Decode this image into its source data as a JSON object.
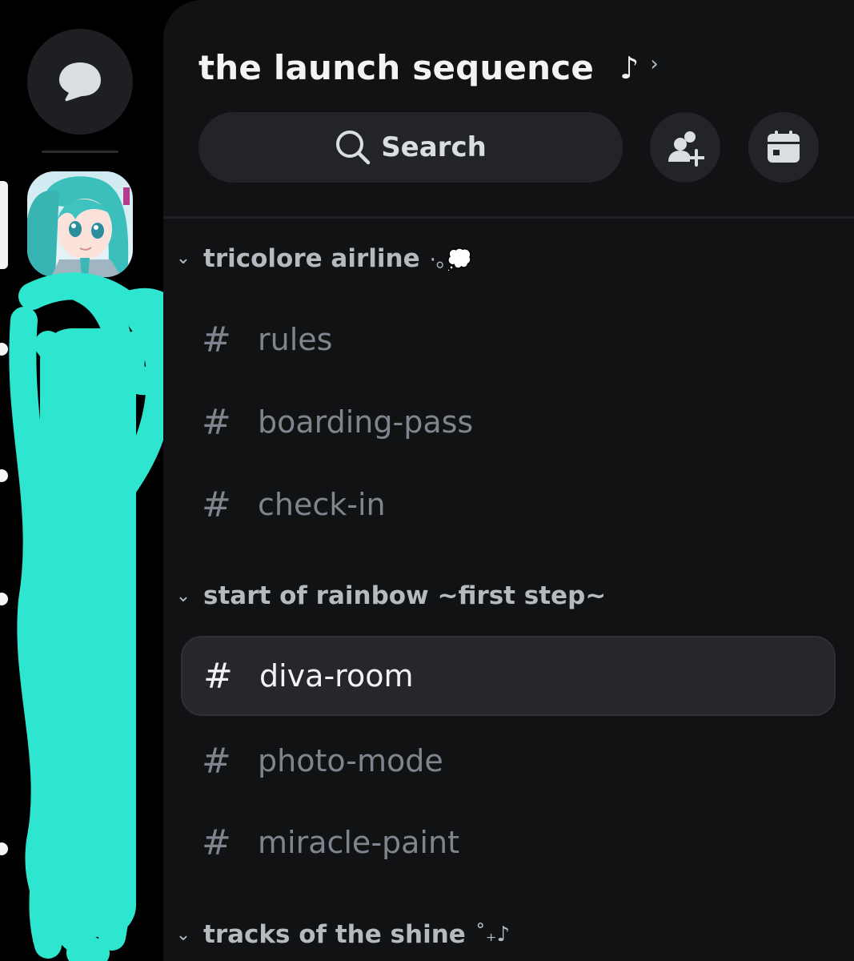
{
  "server": {
    "name": "the launch sequence",
    "name_note": "♪",
    "chevron": "›"
  },
  "search": {
    "label": "Search",
    "icon": "search-icon"
  },
  "actions": {
    "invite_icon": "add-member-icon",
    "events_icon": "calendar-icon"
  },
  "rail": {
    "dm_icon": "chat-bubble-icon"
  },
  "categories": [
    {
      "label": "tricolore airline",
      "deco": "·｡💭",
      "channels": [
        {
          "name": "rules"
        },
        {
          "name": "boarding-pass"
        },
        {
          "name": "check-in"
        }
      ]
    },
    {
      "label": "start of rainbow ~first step~",
      "deco": "",
      "channels": [
        {
          "name": "diva-room",
          "active": true
        },
        {
          "name": "photo-mode"
        },
        {
          "name": "miracle-paint"
        }
      ]
    },
    {
      "label": "tracks of the shine",
      "deco": "˚₊♪",
      "channels": []
    }
  ],
  "symbols": {
    "hash": "#",
    "collapse": "⌄"
  },
  "colors": {
    "background": "#000000",
    "panel": "#111214",
    "active_channel": "#26272c",
    "muted_text": "#80848e",
    "scribble": "#2ee6d0"
  }
}
